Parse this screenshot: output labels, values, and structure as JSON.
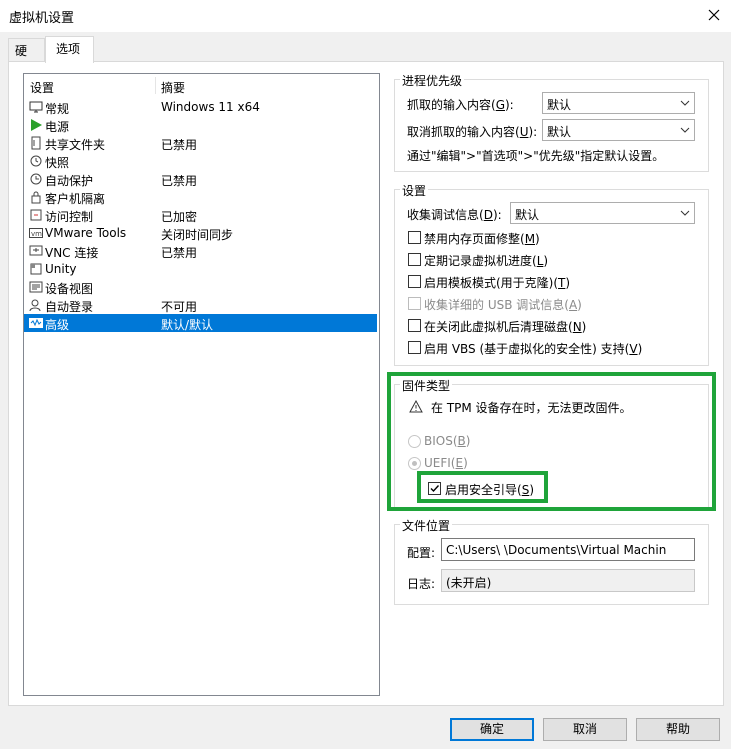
{
  "window": {
    "title": "虚拟机设置"
  },
  "tabs": [
    {
      "label": "硬件"
    },
    {
      "label": "选项"
    }
  ],
  "settings_list": {
    "col_setting": "设置",
    "col_summary": "摘要",
    "items": [
      {
        "name": "常规",
        "summary": "Windows 11 x64",
        "icon": "monitor-icon"
      },
      {
        "name": "电源",
        "summary": "",
        "icon": "play-icon"
      },
      {
        "name": "共享文件夹",
        "summary": "已禁用",
        "icon": "shared-folder-icon"
      },
      {
        "name": "快照",
        "summary": "",
        "icon": "snapshot-icon"
      },
      {
        "name": "自动保护",
        "summary": "已禁用",
        "icon": "autoprotect-icon"
      },
      {
        "name": "客户机隔离",
        "summary": "",
        "icon": "lock-icon"
      },
      {
        "name": "访问控制",
        "summary": "已加密",
        "icon": "access-control-icon"
      },
      {
        "name": "VMware Tools",
        "summary": "关闭时间同步",
        "icon": "vm-icon"
      },
      {
        "name": "VNC 连接",
        "summary": "已禁用",
        "icon": "vnc-icon"
      },
      {
        "name": "Unity",
        "summary": "",
        "icon": "unity-icon"
      },
      {
        "name": "设备视图",
        "summary": "",
        "icon": "device-view-icon"
      },
      {
        "name": "自动登录",
        "summary": "不可用",
        "icon": "autologin-icon"
      },
      {
        "name": "高级",
        "summary": "默认/默认",
        "icon": "advanced-icon",
        "selected": true
      }
    ]
  },
  "process_priority": {
    "title": "进程优先级",
    "grab_label": "抓取的输入内容(",
    "grab_key": "G",
    "grab_tail": "):",
    "grab_value": "默认",
    "ungrab_label": "取消抓取的输入内容(",
    "ungrab_key": "U",
    "ungrab_tail": "):",
    "ungrab_value": "默认",
    "hint": "通过\"编辑\">\"首选项\">\"优先级\"指定默认设置。"
  },
  "settings": {
    "title": "设置",
    "collect_label": "收集调试信息(",
    "collect_key": "D",
    "collect_tail": "):",
    "collect_value": "默认",
    "checkboxes": [
      {
        "label": "禁用内存页面修整(",
        "key": "M",
        "tail": ")",
        "checked": false,
        "enabled": true
      },
      {
        "label": "定期记录虚拟机进度(",
        "key": "L",
        "tail": ")",
        "checked": false,
        "enabled": true
      },
      {
        "label": "启用模板模式(用于克隆)(",
        "key": "T",
        "tail": ")",
        "checked": false,
        "enabled": true
      },
      {
        "label": "收集详细的 USB 调试信息(",
        "key": "A",
        "tail": ")",
        "checked": false,
        "enabled": false
      },
      {
        "label": "在关闭此虚拟机后清理磁盘(",
        "key": "N",
        "tail": ")",
        "checked": false,
        "enabled": true
      },
      {
        "label": "启用 VBS (基于虚拟化的安全性) 支持(",
        "key": "V",
        "tail": ")",
        "checked": false,
        "enabled": true
      }
    ]
  },
  "firmware": {
    "title": "固件类型",
    "warning": "在 TPM 设备存在时，无法更改固件。",
    "bios_label": "BIOS(",
    "bios_key": "B",
    "bios_tail": ")",
    "uefi_label": "UEFI(",
    "uefi_key": "E",
    "uefi_tail": ")",
    "secure_boot_label": "启用安全引导(",
    "secure_boot_key": "S",
    "secure_boot_tail": ")",
    "secure_boot_checked": true,
    "selected": "UEFI",
    "highlight_color": "#1fa43a"
  },
  "file_location": {
    "title": "文件位置",
    "config_label": "配置:",
    "config_value": "C:\\Users\\        \\Documents\\Virtual Machin",
    "log_label": "日志:",
    "log_value": "(未开启)"
  },
  "buttons": {
    "ok": "确定",
    "cancel": "取消",
    "help": "帮助"
  }
}
